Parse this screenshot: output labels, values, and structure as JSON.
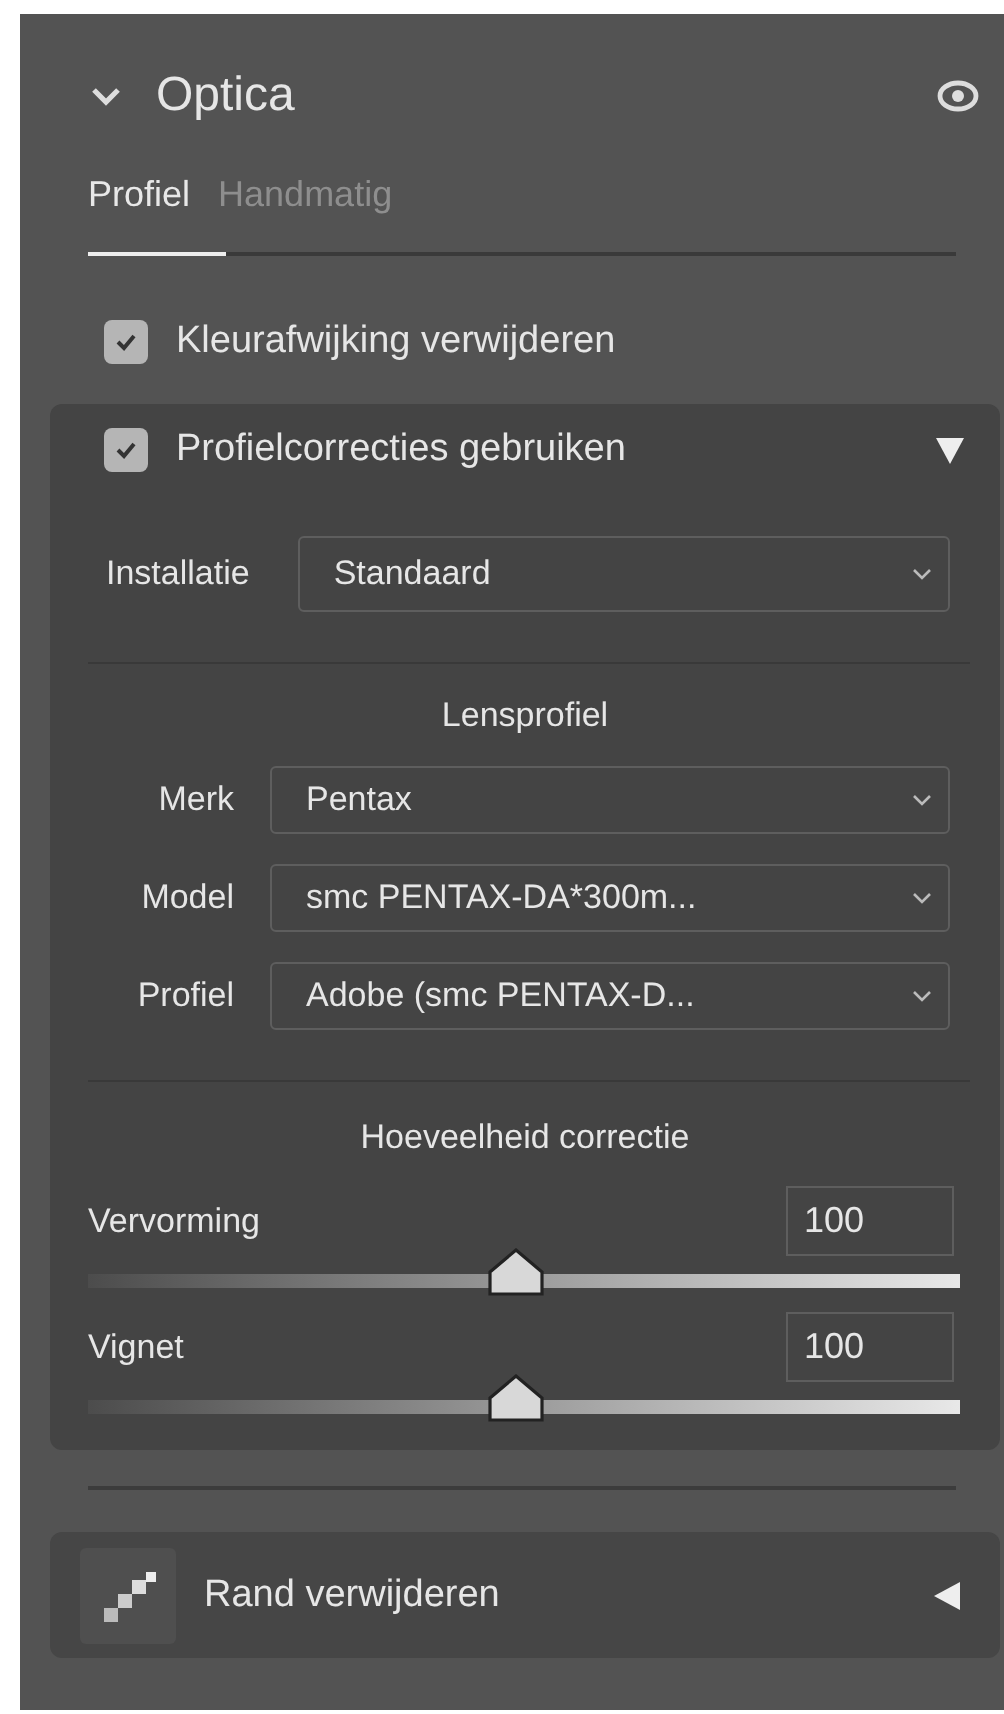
{
  "panel": {
    "title": "Optica",
    "expanded": true
  },
  "tabs": [
    {
      "label": "Profiel",
      "selected": true
    },
    {
      "label": "Handmatig",
      "selected": false
    }
  ],
  "remove_chromatic": {
    "label": "Kleurafwijking verwijderen",
    "checked": true
  },
  "profile_corrections": {
    "label": "Profielcorrecties gebruiken",
    "checked": true,
    "expanded": true,
    "setup": {
      "label": "Installatie",
      "value": "Standaard"
    },
    "lens_profile_title": "Lensprofiel",
    "lens_fields": [
      {
        "label": "Merk",
        "value": "Pentax"
      },
      {
        "label": "Model",
        "value": "smc PENTAX-DA*300m..."
      },
      {
        "label": "Profiel",
        "value": "Adobe (smc PENTAX-D..."
      }
    ],
    "amount_title": "Hoeveelheid correctie",
    "sliders": [
      {
        "label": "Vervorming",
        "value": "100",
        "level": 0.49
      },
      {
        "label": "Vignet",
        "value": "100",
        "level": 0.49
      }
    ]
  },
  "defringe": {
    "label": "Rand verwijderen",
    "expanded": false
  }
}
